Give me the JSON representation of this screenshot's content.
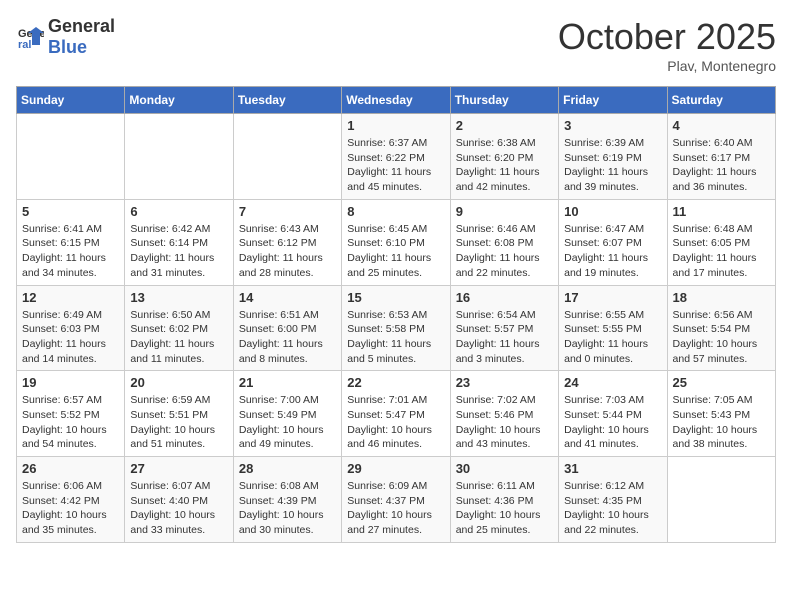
{
  "header": {
    "logo_general": "General",
    "logo_blue": "Blue",
    "month_title": "October 2025",
    "location": "Plav, Montenegro"
  },
  "days_of_week": [
    "Sunday",
    "Monday",
    "Tuesday",
    "Wednesday",
    "Thursday",
    "Friday",
    "Saturday"
  ],
  "weeks": [
    [
      {
        "day": "",
        "info": ""
      },
      {
        "day": "",
        "info": ""
      },
      {
        "day": "",
        "info": ""
      },
      {
        "day": "1",
        "info": "Sunrise: 6:37 AM\nSunset: 6:22 PM\nDaylight: 11 hours\nand 45 minutes."
      },
      {
        "day": "2",
        "info": "Sunrise: 6:38 AM\nSunset: 6:20 PM\nDaylight: 11 hours\nand 42 minutes."
      },
      {
        "day": "3",
        "info": "Sunrise: 6:39 AM\nSunset: 6:19 PM\nDaylight: 11 hours\nand 39 minutes."
      },
      {
        "day": "4",
        "info": "Sunrise: 6:40 AM\nSunset: 6:17 PM\nDaylight: 11 hours\nand 36 minutes."
      }
    ],
    [
      {
        "day": "5",
        "info": "Sunrise: 6:41 AM\nSunset: 6:15 PM\nDaylight: 11 hours\nand 34 minutes."
      },
      {
        "day": "6",
        "info": "Sunrise: 6:42 AM\nSunset: 6:14 PM\nDaylight: 11 hours\nand 31 minutes."
      },
      {
        "day": "7",
        "info": "Sunrise: 6:43 AM\nSunset: 6:12 PM\nDaylight: 11 hours\nand 28 minutes."
      },
      {
        "day": "8",
        "info": "Sunrise: 6:45 AM\nSunset: 6:10 PM\nDaylight: 11 hours\nand 25 minutes."
      },
      {
        "day": "9",
        "info": "Sunrise: 6:46 AM\nSunset: 6:08 PM\nDaylight: 11 hours\nand 22 minutes."
      },
      {
        "day": "10",
        "info": "Sunrise: 6:47 AM\nSunset: 6:07 PM\nDaylight: 11 hours\nand 19 minutes."
      },
      {
        "day": "11",
        "info": "Sunrise: 6:48 AM\nSunset: 6:05 PM\nDaylight: 11 hours\nand 17 minutes."
      }
    ],
    [
      {
        "day": "12",
        "info": "Sunrise: 6:49 AM\nSunset: 6:03 PM\nDaylight: 11 hours\nand 14 minutes."
      },
      {
        "day": "13",
        "info": "Sunrise: 6:50 AM\nSunset: 6:02 PM\nDaylight: 11 hours\nand 11 minutes."
      },
      {
        "day": "14",
        "info": "Sunrise: 6:51 AM\nSunset: 6:00 PM\nDaylight: 11 hours\nand 8 minutes."
      },
      {
        "day": "15",
        "info": "Sunrise: 6:53 AM\nSunset: 5:58 PM\nDaylight: 11 hours\nand 5 minutes."
      },
      {
        "day": "16",
        "info": "Sunrise: 6:54 AM\nSunset: 5:57 PM\nDaylight: 11 hours\nand 3 minutes."
      },
      {
        "day": "17",
        "info": "Sunrise: 6:55 AM\nSunset: 5:55 PM\nDaylight: 11 hours\nand 0 minutes."
      },
      {
        "day": "18",
        "info": "Sunrise: 6:56 AM\nSunset: 5:54 PM\nDaylight: 10 hours\nand 57 minutes."
      }
    ],
    [
      {
        "day": "19",
        "info": "Sunrise: 6:57 AM\nSunset: 5:52 PM\nDaylight: 10 hours\nand 54 minutes."
      },
      {
        "day": "20",
        "info": "Sunrise: 6:59 AM\nSunset: 5:51 PM\nDaylight: 10 hours\nand 51 minutes."
      },
      {
        "day": "21",
        "info": "Sunrise: 7:00 AM\nSunset: 5:49 PM\nDaylight: 10 hours\nand 49 minutes."
      },
      {
        "day": "22",
        "info": "Sunrise: 7:01 AM\nSunset: 5:47 PM\nDaylight: 10 hours\nand 46 minutes."
      },
      {
        "day": "23",
        "info": "Sunrise: 7:02 AM\nSunset: 5:46 PM\nDaylight: 10 hours\nand 43 minutes."
      },
      {
        "day": "24",
        "info": "Sunrise: 7:03 AM\nSunset: 5:44 PM\nDaylight: 10 hours\nand 41 minutes."
      },
      {
        "day": "25",
        "info": "Sunrise: 7:05 AM\nSunset: 5:43 PM\nDaylight: 10 hours\nand 38 minutes."
      }
    ],
    [
      {
        "day": "26",
        "info": "Sunrise: 6:06 AM\nSunset: 4:42 PM\nDaylight: 10 hours\nand 35 minutes."
      },
      {
        "day": "27",
        "info": "Sunrise: 6:07 AM\nSunset: 4:40 PM\nDaylight: 10 hours\nand 33 minutes."
      },
      {
        "day": "28",
        "info": "Sunrise: 6:08 AM\nSunset: 4:39 PM\nDaylight: 10 hours\nand 30 minutes."
      },
      {
        "day": "29",
        "info": "Sunrise: 6:09 AM\nSunset: 4:37 PM\nDaylight: 10 hours\nand 27 minutes."
      },
      {
        "day": "30",
        "info": "Sunrise: 6:11 AM\nSunset: 4:36 PM\nDaylight: 10 hours\nand 25 minutes."
      },
      {
        "day": "31",
        "info": "Sunrise: 6:12 AM\nSunset: 4:35 PM\nDaylight: 10 hours\nand 22 minutes."
      },
      {
        "day": "",
        "info": ""
      }
    ]
  ]
}
